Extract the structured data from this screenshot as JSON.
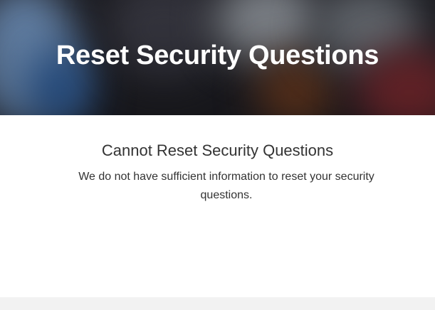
{
  "hero": {
    "title": "Reset Security Questions"
  },
  "main": {
    "heading": "Cannot Reset Security Questions",
    "message": "We do not have sufficient information to reset your security questions."
  },
  "colors": {
    "heading_text": "#333333",
    "hero_text": "#ffffff",
    "footer_background": "#f2f2f2"
  }
}
